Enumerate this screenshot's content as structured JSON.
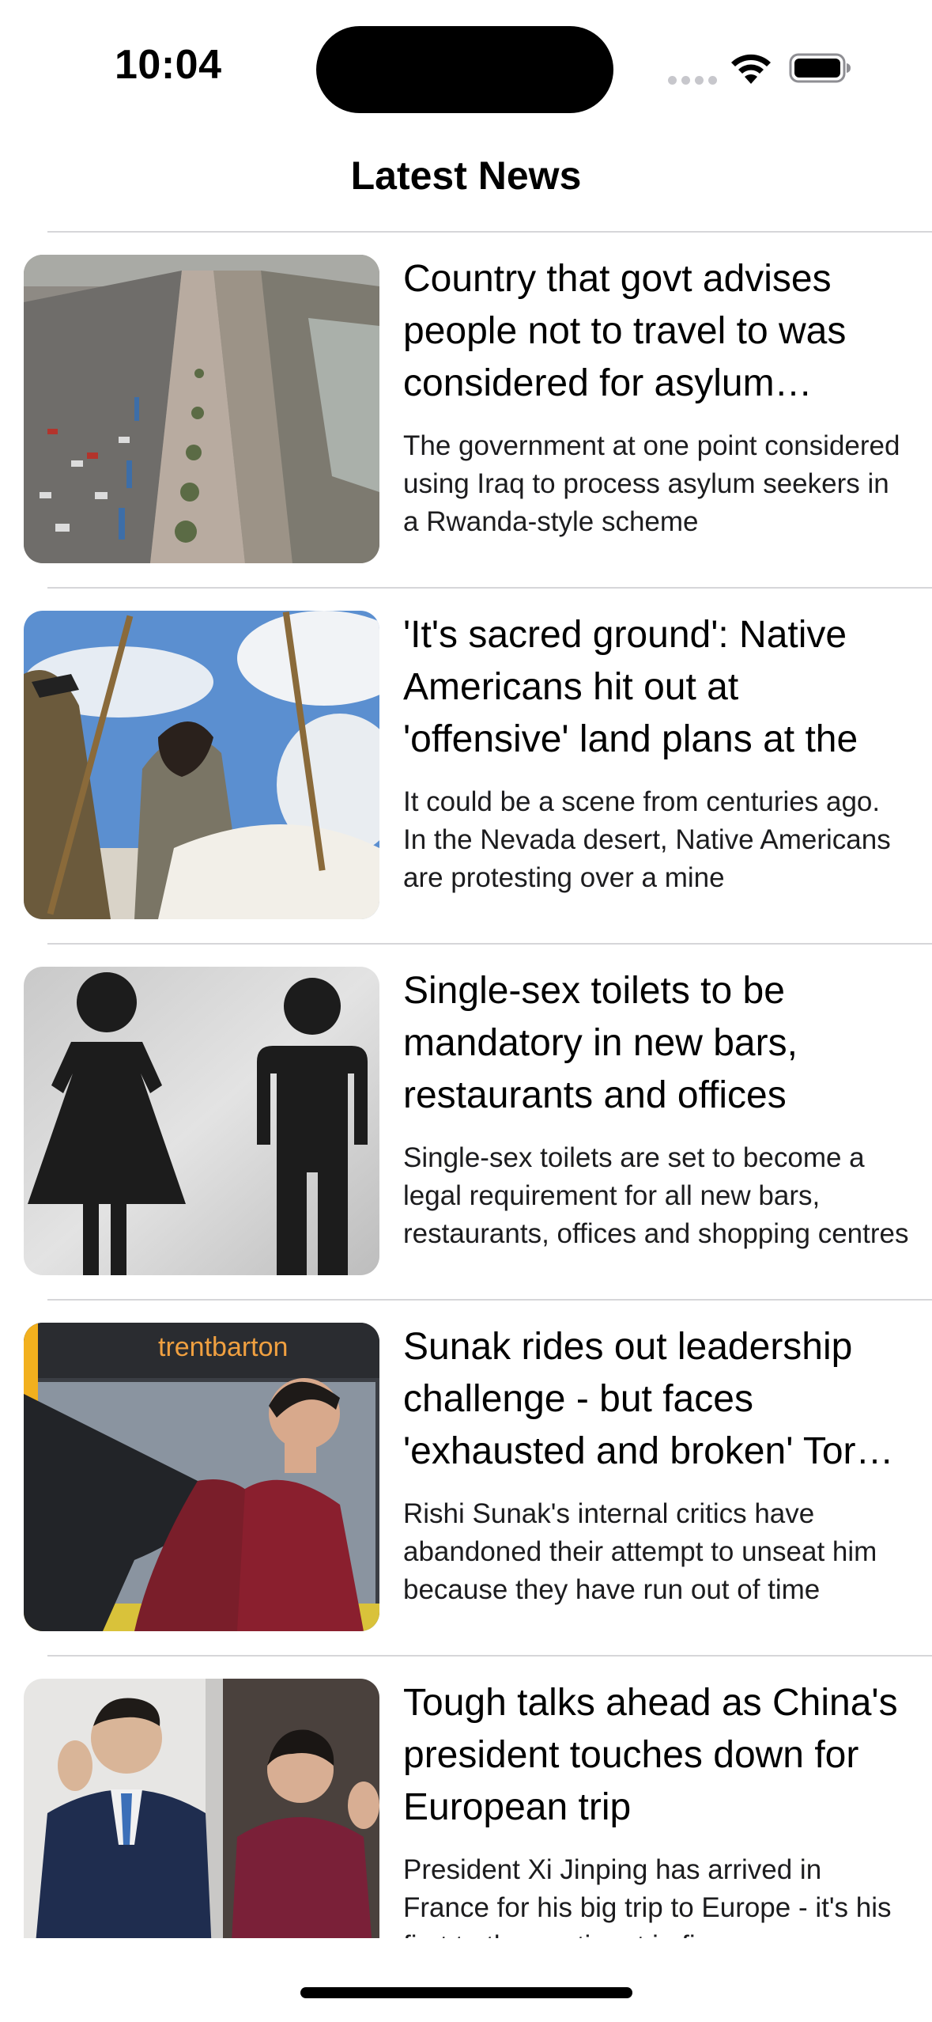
{
  "status_bar": {
    "time": "10:04",
    "icons": [
      "cellular-signal-icon",
      "wifi-icon",
      "battery-icon"
    ]
  },
  "nav": {
    "title": "Latest News"
  },
  "articles": [
    {
      "title": "Country that govt advises people not to travel to was considered for asylum seekers",
      "summary": "The government at one point considered using Iraq to process asylum seekers in a Rwanda-style scheme",
      "image": "aerial-street-photo"
    },
    {
      "title": "'It's sacred ground': Native Americans hit out at 'offensive' land plans at the",
      "summary": "It could be a scene from centuries ago. In the Nevada desert, Native Americans are protesting over a mine",
      "image": "horseback-protesters-photo"
    },
    {
      "title": "Single-sex toilets to be mandatory in new bars, restaurants and offices",
      "summary": "Single-sex toilets are set to become a legal requirement for all new bars, restaurants, offices and shopping centres",
      "image": "toilet-sign-photo"
    },
    {
      "title": "Sunak rides out leadership challenge - but faces 'exhausted and broken' Tory party",
      "summary": "Rishi Sunak's internal critics have abandoned their attempt to unseat him because they have run out of time",
      "image": "bus-jacket-photo"
    },
    {
      "title": "Tough talks ahead as China's president touches down for European trip",
      "summary": "President Xi Jinping has arrived in France for his big trip to Europe - it's his first to the continent in five years",
      "image": "waving-couple-photo"
    }
  ]
}
